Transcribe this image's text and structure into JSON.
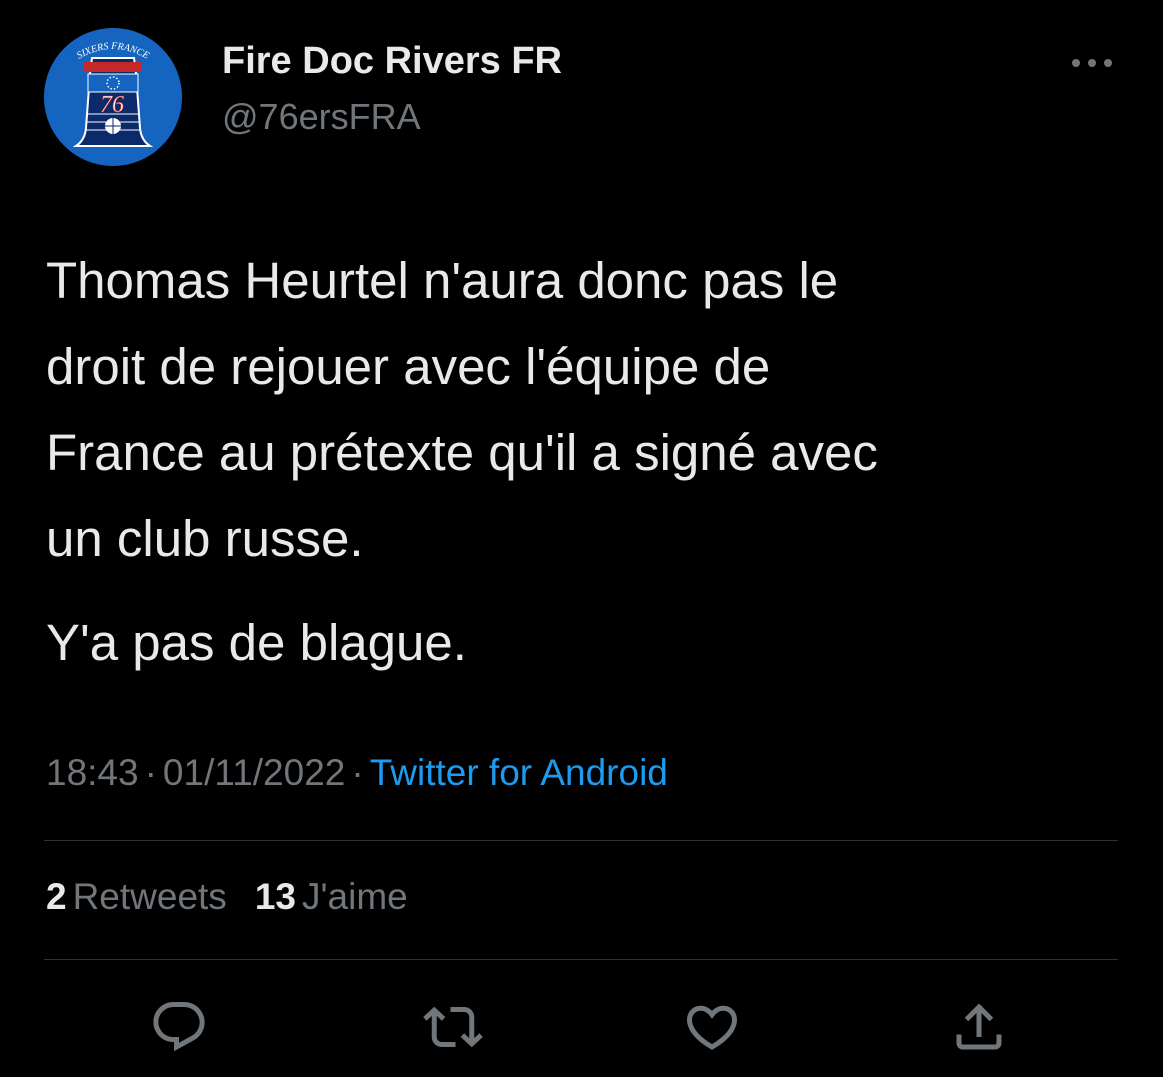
{
  "author": {
    "display_name": "Fire Doc Rivers FR",
    "handle": "@76ersFRA",
    "avatar_logo_text_top": "SIXERS FRANCE",
    "avatar_logo_number": "76",
    "avatar_bg_color": "#1565c0"
  },
  "more_icon": "more-horizontal-icon",
  "tweet": {
    "paragraphs": [
      "Thomas Heurtel n'aura donc pas le\ndroit de rejouer avec l'équipe de\nFrance au prétexte qu'il a signé avec\nun club russe.",
      "Y'a pas de blague."
    ]
  },
  "meta": {
    "time": "18:43",
    "separator": "·",
    "date": "01/11/2022",
    "source": "Twitter for Android"
  },
  "stats": {
    "retweets_count": "2",
    "retweets_label": "Retweets",
    "likes_count": "13",
    "likes_label": "J'aime"
  },
  "actions": [
    {
      "icon": "reply-icon"
    },
    {
      "icon": "retweet-icon"
    },
    {
      "icon": "like-icon"
    },
    {
      "icon": "share-icon"
    }
  ],
  "colors": {
    "background": "#000000",
    "text_primary": "#e7e9ea",
    "text_secondary": "#71767b",
    "link": "#1d9bf0",
    "divider": "#2f3336"
  }
}
